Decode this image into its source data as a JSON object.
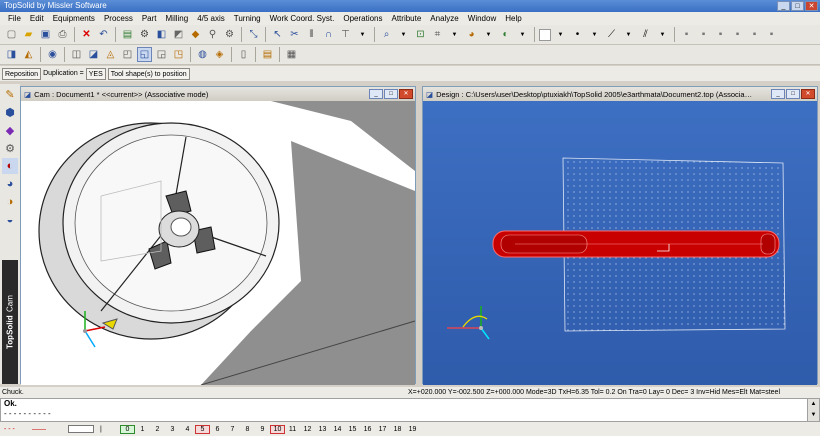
{
  "app": {
    "title": "TopSolid by Missler Software"
  },
  "window_buttons": [
    "_",
    "□",
    "✕"
  ],
  "menu": [
    "File",
    "Edit",
    "Equipments",
    "Process",
    "Part",
    "Milling",
    "4/5 axis",
    "Turning",
    "Work Coord. Syst.",
    "Operations",
    "Attribute",
    "Analyze",
    "Window",
    "Help"
  ],
  "commandbar": {
    "reposition": "Reposition",
    "duplication_label": "Duplication =",
    "duplication_value": "YES",
    "tool_shapes": "Tool shape(s) to position"
  },
  "side_tab": {
    "brand": "TopSolid",
    "mode": "Cam"
  },
  "cam_window": {
    "title": "Cam : Document1 *  <<current>>  (Associative mode)"
  },
  "design_window": {
    "title": "Design : C:\\Users\\user\\Desktop\\ptuxiakh\\TopSolid 2005\\e3arthmata\\Document2.top (Associative..."
  },
  "status": {
    "prompt": "Chuck.",
    "coords": "X=+020.000  Y=-002.500  Z=+000.000  Mode=3D  TxH=6.35  Tol=  0.2  On  Tra=0  Lay= 0  Dec= 3  Inv=Hid  Mes=Elt  Mat=steel"
  },
  "messages": {
    "line1": "Ok.",
    "line2": "- - - - - - - - - -"
  },
  "layers": [
    "0",
    "1",
    "2",
    "3",
    "4",
    "5",
    "6",
    "7",
    "8",
    "9",
    "10",
    "11",
    "12",
    "13",
    "14",
    "15",
    "16",
    "17",
    "18",
    "19"
  ],
  "colors": {
    "accent_title": "#3a6fc4",
    "viewport_blue": "#2f5bab",
    "part_red": "#c80000"
  }
}
